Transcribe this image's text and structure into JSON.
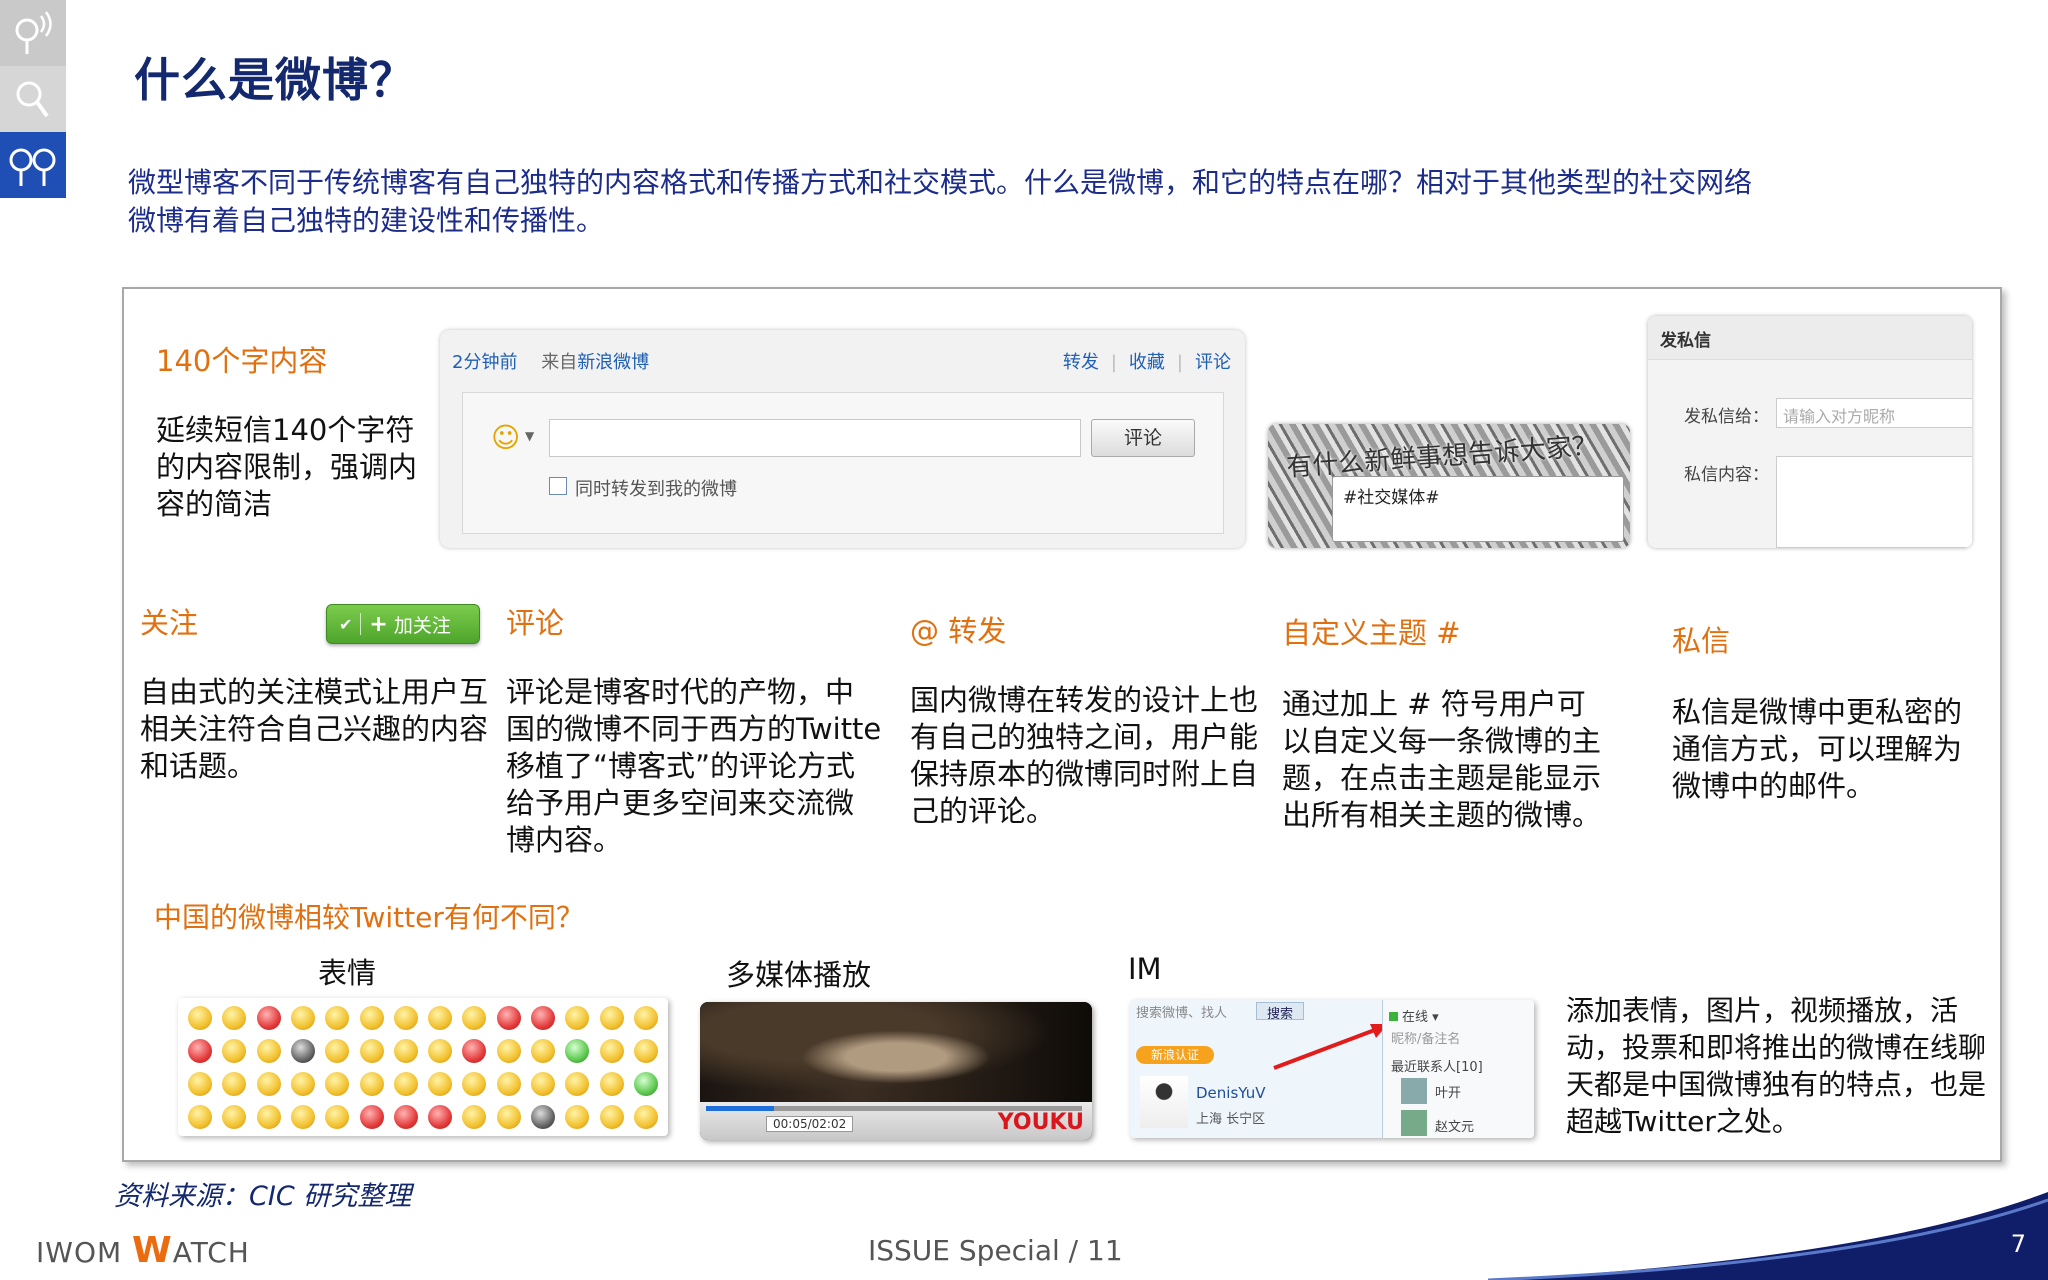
{
  "slide": {
    "title": "什么是微博？",
    "intro_line1": "微型博客不同于传统博客有自己独特的内容格式和传播方式和社交模式。什么是微博，和它的特点在哪？相对于其他类型的社交网络",
    "intro_line2": "微博有着自己独特的建设性和传播性。",
    "page_number": "7"
  },
  "sidebar_icons": [
    "antenna-person-icon",
    "search-person-icon",
    "two-people-icon"
  ],
  "section_140": {
    "heading": "140个字内容",
    "body": "延续短信140个字符的内容限制，强调内容的简洁"
  },
  "comment_widget": {
    "time": "2分钟前",
    "from_prefix": "来自",
    "source": "新浪微博",
    "actions": [
      "转发",
      "收藏",
      "评论"
    ],
    "submit_label": "评论",
    "checkbox_label": "同时转发到我的微博"
  },
  "topic_widget": {
    "caption": "有什么新鲜事想告诉大家？",
    "value": "#社交媒体#"
  },
  "pm_widget": {
    "header": "发私信",
    "to_label": "发私信给：",
    "to_placeholder": "请输入对方昵称",
    "content_label": "私信内容："
  },
  "features": {
    "follow": {
      "heading": "关注",
      "button_label": "加关注",
      "body": "自由式的关注模式让用户互相关注符合自己兴趣的内容和话题。"
    },
    "comment": {
      "heading": "评论",
      "body": "评论是博客时代的产物，中国的微博不同于西方的Twitte移植了“博客式”的评论方式给予用户更多空间来交流微博内容。"
    },
    "repost": {
      "heading": "@ 转发",
      "body": "国内微博在转发的设计上也有自己的独特之间，用户能保持原本的微博同时附上自己的评论。"
    },
    "topic": {
      "heading": "自定义主题 #",
      "body": "通过加上 # 符号用户可以自定义每一条微博的主题，在点击主题是能显示出所有相关主题的微博。"
    },
    "private": {
      "heading": "私信",
      "body": "私信是微博中更私密的通信方式，可以理解为微博中的邮件。"
    }
  },
  "comparison": {
    "heading": "中国的微博相较Twitter有何不同？",
    "emoji_label": "表情",
    "media_label": "多媒体播放",
    "im_label": "IM",
    "video_time": "00:05/02:02",
    "video_brand": "YOUKU",
    "im": {
      "search": "搜索微博、找人",
      "search_btn": "搜索",
      "badge": "新浪认证",
      "name": "DenisYuV",
      "location": "上海 长宁区",
      "status": "在线",
      "remark": "昵称/备注名",
      "recent": "最近联系人[10]",
      "contact1": "叶开",
      "contact2": "赵文元"
    },
    "summary": "添加表情，图片，视频播放，活动，投票和即将推出的微博在线聊天都是中国微博独有的特点，也是超越Twitter之处。"
  },
  "footer": {
    "source": "资料来源：CIC 研究整理",
    "brand_prefix": "IWOM ",
    "brand_w": "W",
    "brand_rest": "ATCH",
    "issue": "ISSUE  Special / 11"
  },
  "colors": {
    "title": "#14286e",
    "intro": "#1c2c8a",
    "orange": "#e07010",
    "side_active": "#1f4fb4"
  }
}
